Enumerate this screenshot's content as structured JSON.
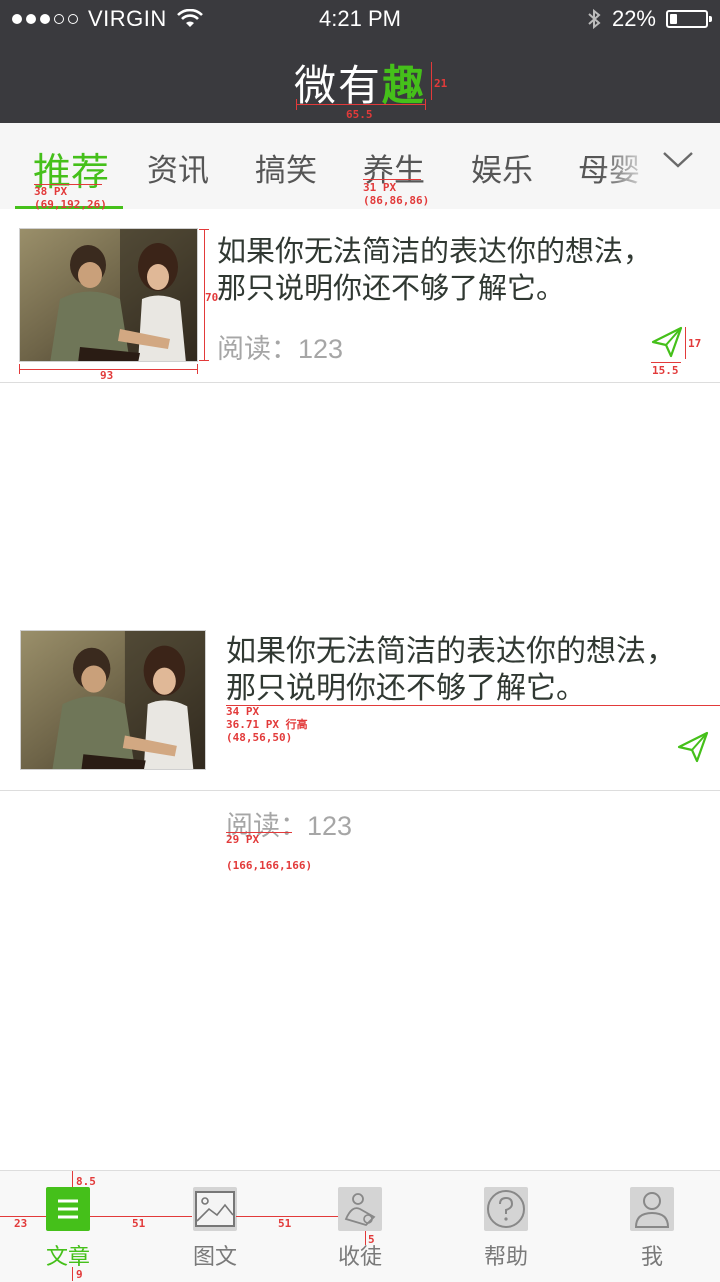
{
  "status_bar": {
    "carrier": "VIRGIN",
    "time": "4:21 PM",
    "battery_percent": "22%",
    "battery_level": 0.22,
    "signal_bars_filled": 3,
    "signal_bars_total": 5
  },
  "header": {
    "title_main": "微有",
    "title_accent": "趣"
  },
  "tabs": [
    {
      "label": "推荐"
    },
    {
      "label": "资讯"
    },
    {
      "label": "搞笑"
    },
    {
      "label": "养生"
    },
    {
      "label": "娱乐"
    },
    {
      "label": "母婴"
    }
  ],
  "articles": [
    {
      "title_line1": "如果你无法简洁的表达你的想法，",
      "title_line2": "那只说明你还不够了解它。",
      "reads_label": "阅读：",
      "reads_count": "123"
    },
    {
      "title_line1": "如果你无法简洁的表达你的想法，",
      "title_line2": "那只说明你还不够了解它。",
      "reads_label": "阅读：",
      "reads_count": "123"
    }
  ],
  "annotations": {
    "logo_width": "65.5",
    "logo_height": "21",
    "tab_active_size": "38 PX",
    "tab_active_color": "(69,192,26)",
    "tab_size": "31 PX",
    "tab_color": "(86,86,86)",
    "thumb_height": "70",
    "thumb_width": "93",
    "share_height": "17",
    "share_width": "15.5",
    "title_size": "34 PX",
    "title_lineheight": "36.71 PX 行高",
    "title_color": "(48,56,50)",
    "reads_size": "29 PX",
    "reads_color": "(166,166,166)",
    "nav_top_gap": "8.5",
    "nav_left_gap": "23",
    "nav_spacing_1": "51",
    "nav_spacing_2": "51",
    "nav_icon_gap": "5",
    "nav_bottom_gap": "9"
  },
  "bottom_nav": [
    {
      "label": "文章"
    },
    {
      "label": "图文"
    },
    {
      "label": "收徒"
    },
    {
      "label": "帮助"
    },
    {
      "label": "我"
    }
  ],
  "colors": {
    "accent": "#45c01a",
    "header_bg": "#3a3a3e",
    "title_text": "#303832",
    "reads_text": "#a6a6a6",
    "tab_text": "#565656",
    "annotation": "#e23a3a"
  }
}
